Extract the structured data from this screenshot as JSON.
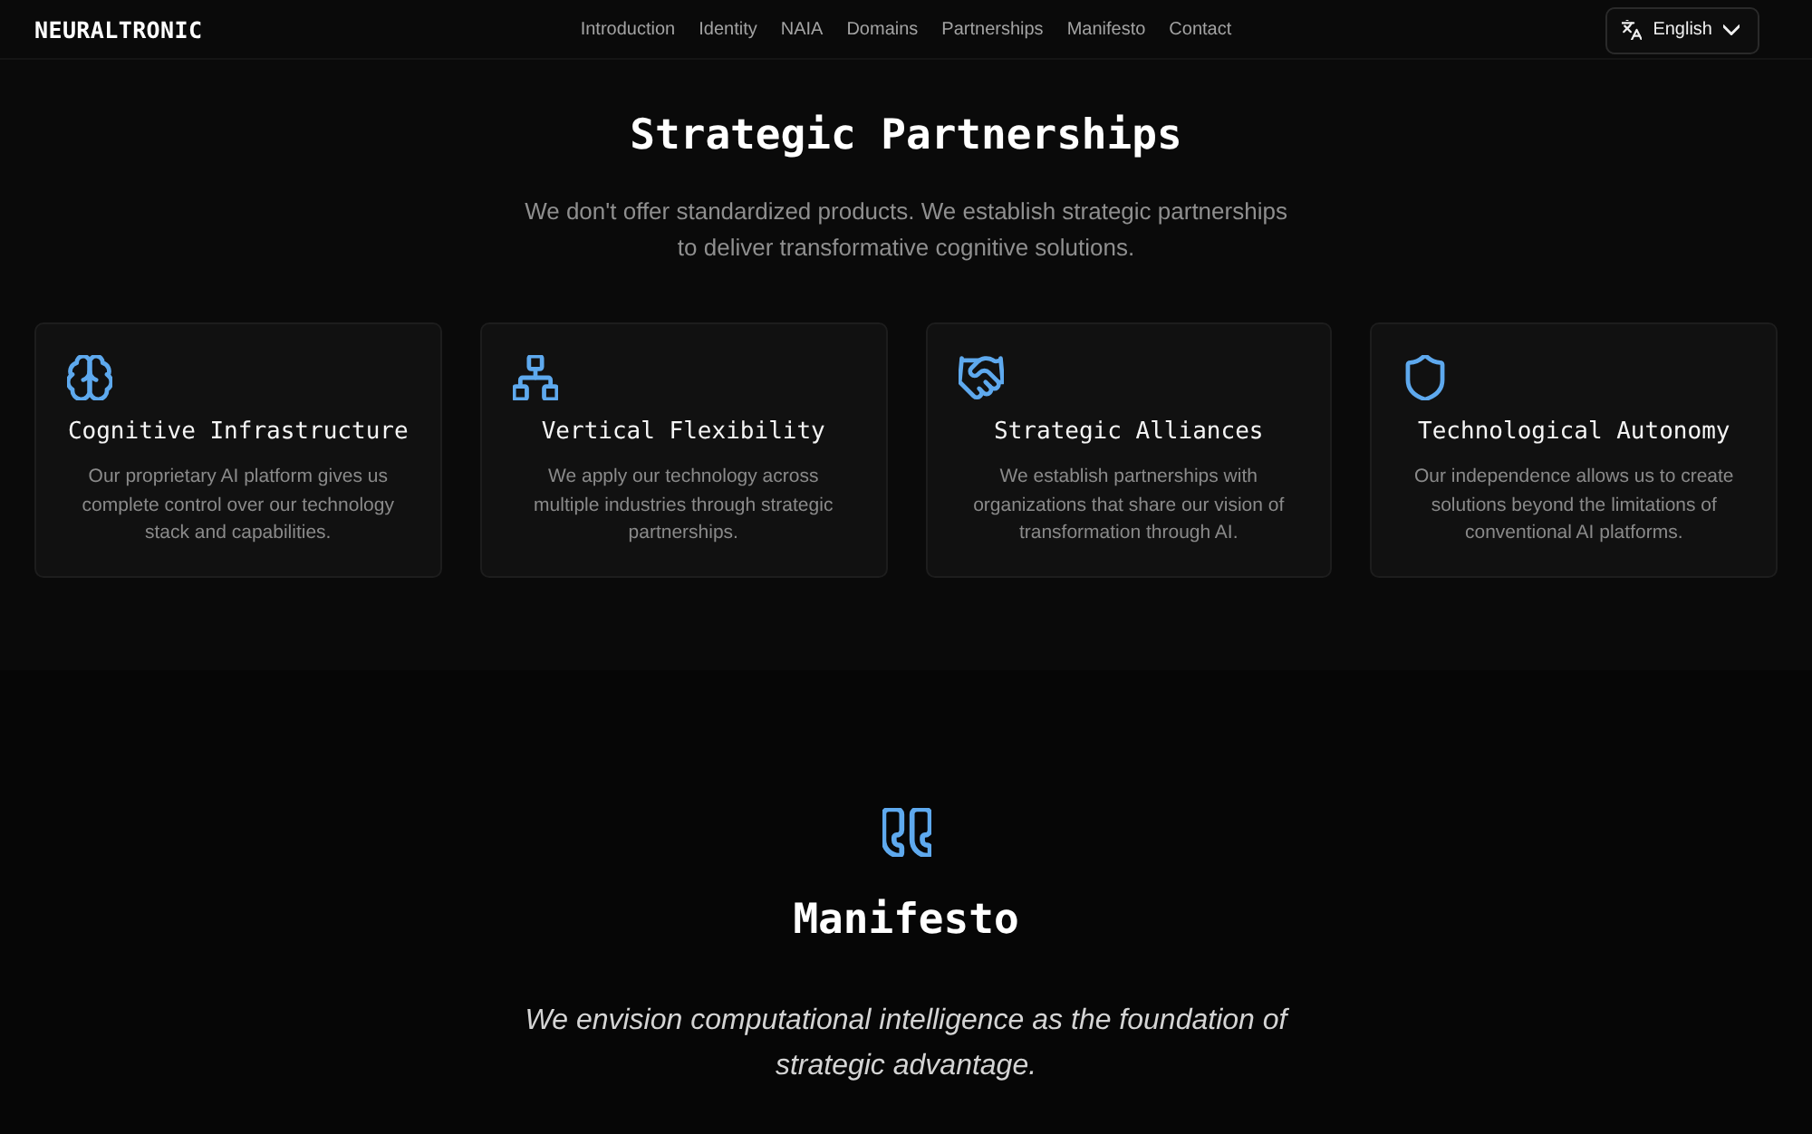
{
  "header": {
    "logo": "NEURALTRONIC",
    "nav_links": [
      "Introduction",
      "Identity",
      "NAIA",
      "Domains",
      "Partnerships",
      "Manifesto",
      "Contact"
    ],
    "language_button": "English"
  },
  "partnerships": {
    "title": "Strategic Partnerships",
    "subtitle": "We don't offer standardized products. We establish strategic partnerships to deliver transformative cognitive solutions.",
    "cards": [
      {
        "title": "Cognitive Infrastructure",
        "description": "Our proprietary AI platform gives us complete control over our technology stack and capabilities."
      },
      {
        "title": "Vertical Flexibility",
        "description": "We apply our technology across multiple industries through strategic partnerships."
      },
      {
        "title": "Strategic Alliances",
        "description": "We establish partnerships with organizations that share our vision of transformation through AI."
      },
      {
        "title": "Technological Autonomy",
        "description": "Our independence allows us to create solutions beyond the limitations of conventional AI platforms."
      }
    ]
  },
  "manifesto": {
    "title": "Manifesto",
    "quote": "We envision computational intelligence as the foundation of strategic advantage."
  }
}
